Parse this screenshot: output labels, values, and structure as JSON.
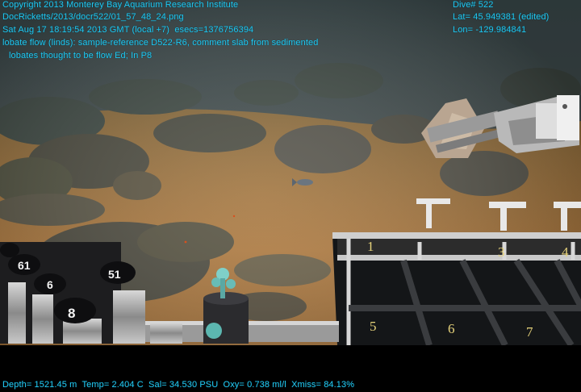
{
  "overlay": {
    "copyright": "Copyright 2013 Monterey Bay Aquarium Research Institute",
    "filename": "DocRicketts/2013/docr522/01_57_48_24.png",
    "timestamp": "Sat Aug 17 18:19:54 2013 GMT (local +7)  esecs=1376756394",
    "comment_line1": "lobate flow (linds): sample-reference D522-R6, comment slab from sedimented",
    "comment_line2": "lobates thought to be flow Ed; In P8",
    "dive": "Dive# 522",
    "lat": "Lat= 45.949381 (edited)",
    "lon": "Lon= -129.984841",
    "telemetry": "Depth= 1521.45 m  Temp= 2.404 C  Sal= 34.530 PSU  Oxy= 0.738 ml/l  Xmiss= 84.13%"
  },
  "crate": {
    "labels": [
      "1",
      "3",
      "4",
      "5",
      "6",
      "7"
    ]
  },
  "caps": {
    "labels": [
      "61",
      "6",
      "51",
      "8"
    ]
  },
  "colors": {
    "overlay_text": "#22c8f0",
    "sediment": "#a8773a",
    "rock": "#4a4a3e"
  }
}
